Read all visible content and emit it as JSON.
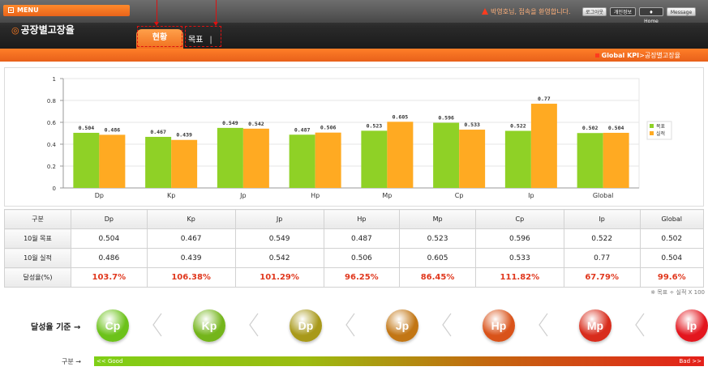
{
  "header": {
    "menu_label": "MENU",
    "page_title": "공장별고장율",
    "welcome": "박영호님, 접속을 환영합니다.",
    "buttons": {
      "logout": "로그아웃",
      "profile": "개인정보",
      "home": "Home",
      "message": "Message"
    },
    "tabs": [
      {
        "label": "현황",
        "active": true
      },
      {
        "label": "목표",
        "active": false
      }
    ],
    "tab_separator": "|",
    "breadcrumb": {
      "root": "Global KPI",
      "sep": ">",
      "current": "공장별고장율"
    }
  },
  "chart_data": {
    "type": "bar",
    "categories": [
      "Dp",
      "Kp",
      "Jp",
      "Hp",
      "Mp",
      "Cp",
      "Ip",
      "Global"
    ],
    "series": [
      {
        "name": "목표",
        "color": "#8fd126",
        "values": [
          0.504,
          0.467,
          0.549,
          0.487,
          0.523,
          0.596,
          0.522,
          0.502
        ]
      },
      {
        "name": "실적",
        "color": "#ffaa22",
        "values": [
          0.486,
          0.439,
          0.542,
          0.506,
          0.605,
          0.533,
          0.77,
          0.504
        ]
      }
    ],
    "ylim": [
      0,
      1
    ],
    "yticks": [
      "0",
      "0.2",
      "0.4",
      "0.6",
      "0.8",
      "1"
    ],
    "legend": "right",
    "grid": true
  },
  "table": {
    "corner": "구분",
    "columns": [
      "Dp",
      "Kp",
      "Jp",
      "Hp",
      "Mp",
      "Cp",
      "Ip",
      "Global"
    ],
    "rows": [
      {
        "label": "10월 목표",
        "cells": [
          "0.504",
          "0.467",
          "0.549",
          "0.487",
          "0.523",
          "0.596",
          "0.522",
          "0.502"
        ]
      },
      {
        "label": "10월 실적",
        "cells": [
          "0.486",
          "0.439",
          "0.542",
          "0.506",
          "0.605",
          "0.533",
          "0.77",
          "0.504"
        ]
      },
      {
        "label": "달성율(%)",
        "cells": [
          "103.7%",
          "106.38%",
          "101.29%",
          "96.25%",
          "86.45%",
          "111.82%",
          "67.79%",
          "99.6%"
        ]
      }
    ],
    "note": "※ 목표 ÷ 실적 X 100"
  },
  "ranking": {
    "label": "달성율 기준 →",
    "items": [
      {
        "label": "Cp",
        "color": "#6cc21a"
      },
      {
        "label": "Kp",
        "color": "#74b51b"
      },
      {
        "label": "Dp",
        "color": "#a8991a"
      },
      {
        "label": "Jp",
        "color": "#c27614"
      },
      {
        "label": "Hp",
        "color": "#d9531a"
      },
      {
        "label": "Mp",
        "color": "#d82c1c"
      },
      {
        "label": "Ip",
        "color": "#e3161e"
      }
    ],
    "grade_label": "구분 →",
    "good": "<< Good",
    "bad": "Bad >>"
  }
}
